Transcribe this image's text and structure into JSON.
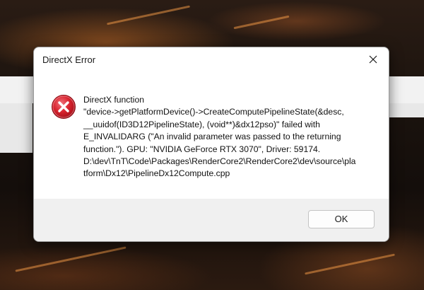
{
  "dialog": {
    "title": "DirectX Error",
    "close_icon": "close-icon",
    "icon": "error-icon",
    "message_lines": [
      "DirectX function",
      "\"device->getPlatformDevice()->CreateComputePipelineState(&desc,",
      "__uuidof(ID3D12PipelineState), (void**)&dx12pso)\" failed with",
      "E_INVALIDARG (\"An invalid parameter was passed to the returning",
      "function.\"). GPU: \"NVIDIA GeForce RTX 3070\", Driver: 59174.",
      "D:\\dev\\TnT\\Code\\Packages\\RenderCore2\\RenderCore2\\dev\\source\\pla",
      "tform\\Dx12\\PipelineDx12Compute.cpp"
    ],
    "ok_label": "OK"
  },
  "colors": {
    "error_red": "#e81123",
    "footer_bg": "#f0f0f0"
  }
}
